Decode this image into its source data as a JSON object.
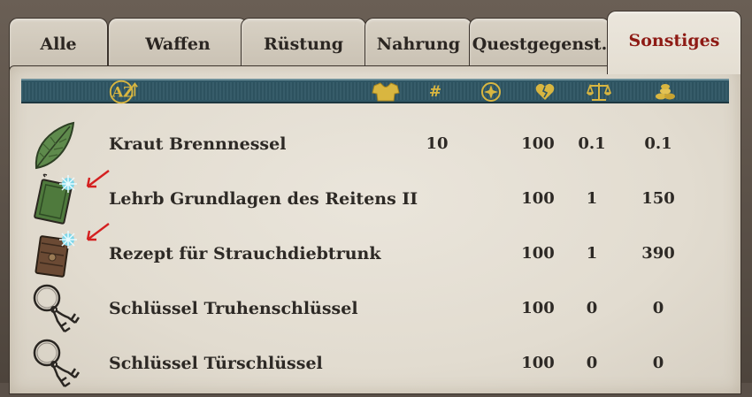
{
  "tabs": [
    {
      "label": "Alle",
      "active": false
    },
    {
      "label": "Waffen",
      "active": false
    },
    {
      "label": "Rüstung",
      "active": false
    },
    {
      "label": "Nahrung",
      "active": false
    },
    {
      "label": "Questgegenst.",
      "active": false
    },
    {
      "label": "Sonstiges",
      "active": true
    }
  ],
  "header": {
    "sort_icon": "az-sort-icon",
    "columns": [
      {
        "icon": "shirt-icon",
        "label": ""
      },
      {
        "icon": "count-icon",
        "label": "#"
      },
      {
        "icon": "cross-shield-icon",
        "label": ""
      },
      {
        "icon": "broken-heart-icon",
        "label": ""
      },
      {
        "icon": "scales-icon",
        "label": ""
      },
      {
        "icon": "coins-icon",
        "label": ""
      }
    ]
  },
  "items": [
    {
      "name": "Kraut Brennnessel",
      "count": "10",
      "condition": "100",
      "weight": "0.1",
      "value": "0.1",
      "icon": "nettle-leaf-icon",
      "marked": false
    },
    {
      "name": "Lehrb Grundlagen des Reitens II",
      "count": "",
      "condition": "100",
      "weight": "1",
      "value": "150",
      "icon": "green-book-icon",
      "marked": true
    },
    {
      "name": "Rezept für Strauchdiebtrunk",
      "count": "",
      "condition": "100",
      "weight": "1",
      "value": "390",
      "icon": "brown-book-icon",
      "marked": true
    },
    {
      "name": "Schlüssel Truhenschlüssel",
      "count": "",
      "condition": "100",
      "weight": "0",
      "value": "0",
      "icon": "key-ring-icon",
      "marked": false
    },
    {
      "name": "Schlüssel Türschlüssel",
      "count": "",
      "condition": "100",
      "weight": "0",
      "value": "0",
      "icon": "key-ring-icon",
      "marked": false
    }
  ],
  "colors": {
    "active_tab_text": "#8e1a14",
    "header_bar": "#2f5664",
    "header_icons": "#d9b640",
    "marker_arrow": "#d42020"
  }
}
